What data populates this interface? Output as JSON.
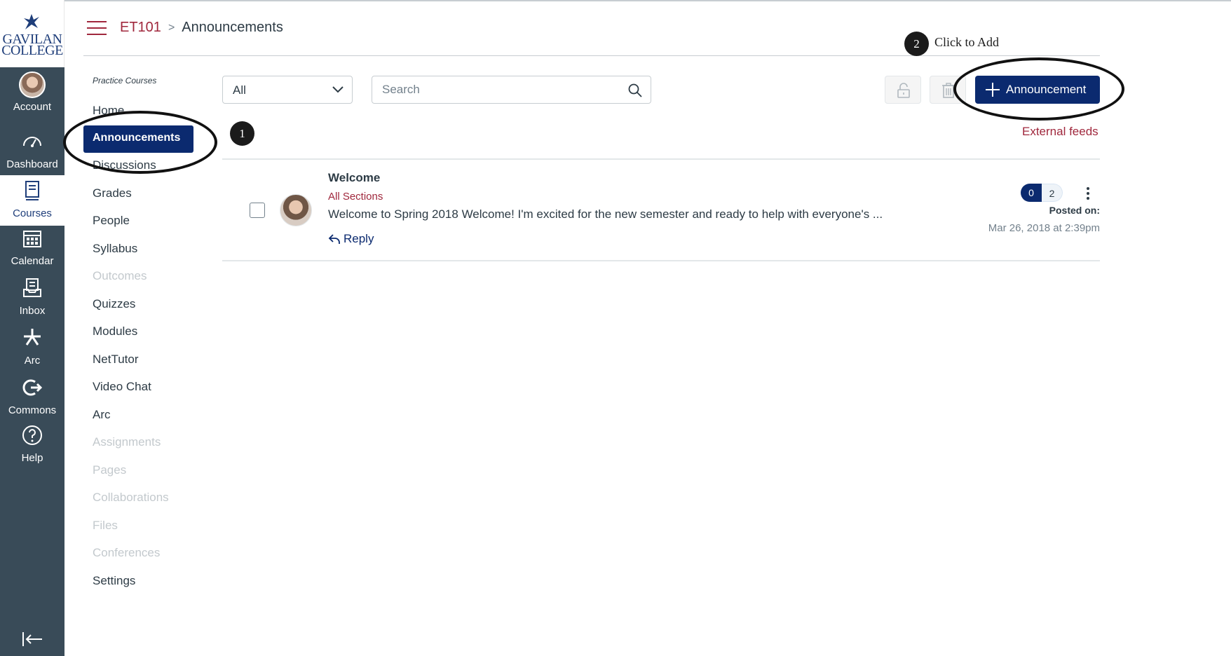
{
  "brand": {
    "logo_line1": "GAVILAN",
    "logo_line2": "COLLEGE",
    "nav_color": "#394b58",
    "accent": "#0b2a6f",
    "link_color": "#a0283d"
  },
  "global_nav": {
    "items": [
      {
        "label": "Account",
        "icon": "avatar"
      },
      {
        "label": "Dashboard",
        "icon": "dashboard-icon"
      },
      {
        "label": "Courses",
        "icon": "courses-icon"
      },
      {
        "label": "Calendar",
        "icon": "calendar-icon"
      },
      {
        "label": "Inbox",
        "icon": "inbox-icon"
      },
      {
        "label": "Arc",
        "icon": "arc-icon"
      },
      {
        "label": "Commons",
        "icon": "commons-icon"
      },
      {
        "label": "Help",
        "icon": "help-icon"
      }
    ]
  },
  "breadcrumb": {
    "course": "ET101",
    "separator": ">",
    "current": "Announcements"
  },
  "course_nav": {
    "label": "Practice Courses",
    "items": [
      {
        "label": "Home"
      },
      {
        "label": "Announcements"
      },
      {
        "label": "Discussions"
      },
      {
        "label": "Grades"
      },
      {
        "label": "People"
      },
      {
        "label": "Syllabus"
      },
      {
        "label": "Outcomes"
      },
      {
        "label": "Quizzes"
      },
      {
        "label": "Modules"
      },
      {
        "label": "NetTutor"
      },
      {
        "label": "Video Chat"
      },
      {
        "label": "Arc"
      },
      {
        "label": "Assignments"
      },
      {
        "label": "Pages"
      },
      {
        "label": "Collaborations"
      },
      {
        "label": "Files"
      },
      {
        "label": "Conferences"
      },
      {
        "label": "Settings"
      }
    ]
  },
  "toolbar": {
    "filter_value": "All",
    "search_placeholder": "Search",
    "add_label": "Announcement",
    "external_feeds": "External feeds"
  },
  "announcement": {
    "title": "Welcome",
    "sections": "All Sections",
    "body": "Welcome to Spring 2018 Welcome!  I'm excited for the new semester and ready to help with everyone's ...",
    "reply_label": "Reply",
    "unread_count": "0",
    "total_count": "2",
    "posted_label": "Posted on:",
    "posted_date": "Mar 26, 2018 at 2:39pm"
  },
  "annotations": {
    "step1": "1",
    "step2": "2",
    "step2_label": "Click to Add"
  }
}
